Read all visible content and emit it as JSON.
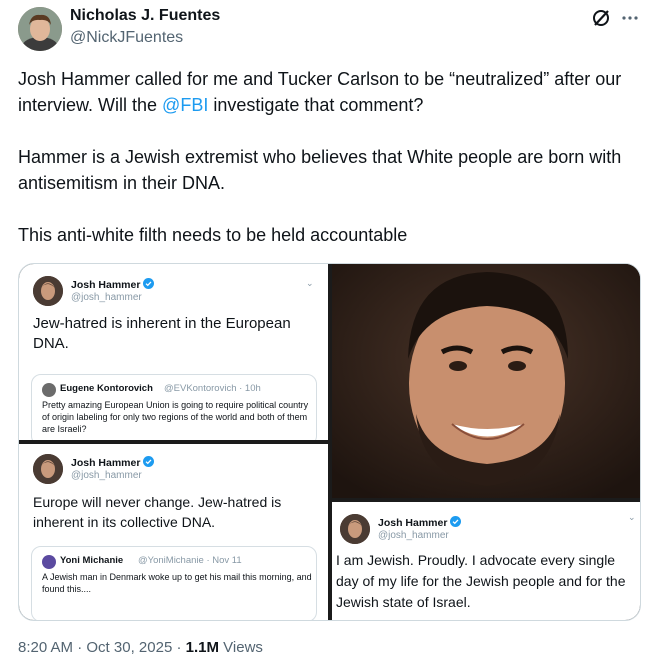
{
  "author": {
    "name": "Nicholas J. Fuentes",
    "handle": "@NickJFuentes"
  },
  "post": {
    "para1_before": "Josh Hammer called for me and Tucker Carlson to be “neutralized” after our interview. Will the ",
    "mention": "@FBI",
    "para1_after": " investigate that comment?",
    "para2": "Hammer is a Jewish extremist who believes that White people are born with antisemitism in their DNA.",
    "para3": "This anti-white filth needs to be held accountable"
  },
  "media": {
    "panel1": {
      "name": "Josh Hammer",
      "handle": "@josh_hammer",
      "text": "Jew-hatred is inherent in the European DNA.",
      "quote": {
        "name": "Eugene Kontorovich",
        "handle": "@EVKontorovich · 10h",
        "text": "Pretty amazing European Union is going to require political country of origin labeling for only two regions of the world and both of them are Israeli?"
      }
    },
    "panel2": {
      "name": "Josh Hammer",
      "handle": "@josh_hammer",
      "text": "Europe will never change. Jew-hatred is inherent in its collective DNA.",
      "quote": {
        "name": "Yoni Michanie",
        "handle": "@YoniMichanie · Nov 11",
        "text": "A Jewish man in Denmark woke up to get his mail this morning, and found this...."
      }
    },
    "panel4": {
      "name": "Josh Hammer",
      "handle": "@josh_hammer",
      "text": "I am Jewish. Proudly. I advocate every single day of my life for the Jewish people and for the Jewish state of Israel."
    }
  },
  "footer": {
    "time": "8:20 AM",
    "sep": " · ",
    "date": "Oct 30, 2025",
    "sep2": " · ",
    "views_count": "1.1M",
    "views_label": " Views"
  },
  "colors": {
    "accent": "#1d9bf0",
    "text": "#0f1419",
    "muted": "#536471"
  },
  "icons": [
    "grok-icon",
    "more-icon",
    "verified-badge-icon"
  ]
}
